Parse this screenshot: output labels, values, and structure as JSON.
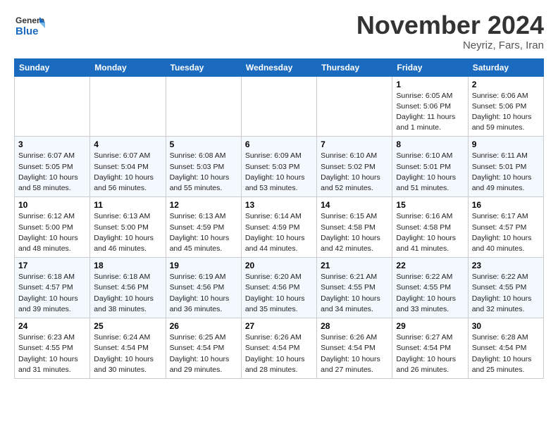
{
  "header": {
    "logo_general": "General",
    "logo_blue": "Blue",
    "month_title": "November 2024",
    "subtitle": "Neyriz, Fars, Iran"
  },
  "days_of_week": [
    "Sunday",
    "Monday",
    "Tuesday",
    "Wednesday",
    "Thursday",
    "Friday",
    "Saturday"
  ],
  "weeks": [
    {
      "days": [
        {
          "num": "",
          "info": ""
        },
        {
          "num": "",
          "info": ""
        },
        {
          "num": "",
          "info": ""
        },
        {
          "num": "",
          "info": ""
        },
        {
          "num": "",
          "info": ""
        },
        {
          "num": "1",
          "info": "Sunrise: 6:05 AM\nSunset: 5:06 PM\nDaylight: 11 hours\nand 1 minute."
        },
        {
          "num": "2",
          "info": "Sunrise: 6:06 AM\nSunset: 5:06 PM\nDaylight: 10 hours\nand 59 minutes."
        }
      ]
    },
    {
      "days": [
        {
          "num": "3",
          "info": "Sunrise: 6:07 AM\nSunset: 5:05 PM\nDaylight: 10 hours\nand 58 minutes."
        },
        {
          "num": "4",
          "info": "Sunrise: 6:07 AM\nSunset: 5:04 PM\nDaylight: 10 hours\nand 56 minutes."
        },
        {
          "num": "5",
          "info": "Sunrise: 6:08 AM\nSunset: 5:03 PM\nDaylight: 10 hours\nand 55 minutes."
        },
        {
          "num": "6",
          "info": "Sunrise: 6:09 AM\nSunset: 5:03 PM\nDaylight: 10 hours\nand 53 minutes."
        },
        {
          "num": "7",
          "info": "Sunrise: 6:10 AM\nSunset: 5:02 PM\nDaylight: 10 hours\nand 52 minutes."
        },
        {
          "num": "8",
          "info": "Sunrise: 6:10 AM\nSunset: 5:01 PM\nDaylight: 10 hours\nand 51 minutes."
        },
        {
          "num": "9",
          "info": "Sunrise: 6:11 AM\nSunset: 5:01 PM\nDaylight: 10 hours\nand 49 minutes."
        }
      ]
    },
    {
      "days": [
        {
          "num": "10",
          "info": "Sunrise: 6:12 AM\nSunset: 5:00 PM\nDaylight: 10 hours\nand 48 minutes."
        },
        {
          "num": "11",
          "info": "Sunrise: 6:13 AM\nSunset: 5:00 PM\nDaylight: 10 hours\nand 46 minutes."
        },
        {
          "num": "12",
          "info": "Sunrise: 6:13 AM\nSunset: 4:59 PM\nDaylight: 10 hours\nand 45 minutes."
        },
        {
          "num": "13",
          "info": "Sunrise: 6:14 AM\nSunset: 4:59 PM\nDaylight: 10 hours\nand 44 minutes."
        },
        {
          "num": "14",
          "info": "Sunrise: 6:15 AM\nSunset: 4:58 PM\nDaylight: 10 hours\nand 42 minutes."
        },
        {
          "num": "15",
          "info": "Sunrise: 6:16 AM\nSunset: 4:58 PM\nDaylight: 10 hours\nand 41 minutes."
        },
        {
          "num": "16",
          "info": "Sunrise: 6:17 AM\nSunset: 4:57 PM\nDaylight: 10 hours\nand 40 minutes."
        }
      ]
    },
    {
      "days": [
        {
          "num": "17",
          "info": "Sunrise: 6:18 AM\nSunset: 4:57 PM\nDaylight: 10 hours\nand 39 minutes."
        },
        {
          "num": "18",
          "info": "Sunrise: 6:18 AM\nSunset: 4:56 PM\nDaylight: 10 hours\nand 38 minutes."
        },
        {
          "num": "19",
          "info": "Sunrise: 6:19 AM\nSunset: 4:56 PM\nDaylight: 10 hours\nand 36 minutes."
        },
        {
          "num": "20",
          "info": "Sunrise: 6:20 AM\nSunset: 4:56 PM\nDaylight: 10 hours\nand 35 minutes."
        },
        {
          "num": "21",
          "info": "Sunrise: 6:21 AM\nSunset: 4:55 PM\nDaylight: 10 hours\nand 34 minutes."
        },
        {
          "num": "22",
          "info": "Sunrise: 6:22 AM\nSunset: 4:55 PM\nDaylight: 10 hours\nand 33 minutes."
        },
        {
          "num": "23",
          "info": "Sunrise: 6:22 AM\nSunset: 4:55 PM\nDaylight: 10 hours\nand 32 minutes."
        }
      ]
    },
    {
      "days": [
        {
          "num": "24",
          "info": "Sunrise: 6:23 AM\nSunset: 4:55 PM\nDaylight: 10 hours\nand 31 minutes."
        },
        {
          "num": "25",
          "info": "Sunrise: 6:24 AM\nSunset: 4:54 PM\nDaylight: 10 hours\nand 30 minutes."
        },
        {
          "num": "26",
          "info": "Sunrise: 6:25 AM\nSunset: 4:54 PM\nDaylight: 10 hours\nand 29 minutes."
        },
        {
          "num": "27",
          "info": "Sunrise: 6:26 AM\nSunset: 4:54 PM\nDaylight: 10 hours\nand 28 minutes."
        },
        {
          "num": "28",
          "info": "Sunrise: 6:26 AM\nSunset: 4:54 PM\nDaylight: 10 hours\nand 27 minutes."
        },
        {
          "num": "29",
          "info": "Sunrise: 6:27 AM\nSunset: 4:54 PM\nDaylight: 10 hours\nand 26 minutes."
        },
        {
          "num": "30",
          "info": "Sunrise: 6:28 AM\nSunset: 4:54 PM\nDaylight: 10 hours\nand 25 minutes."
        }
      ]
    }
  ]
}
